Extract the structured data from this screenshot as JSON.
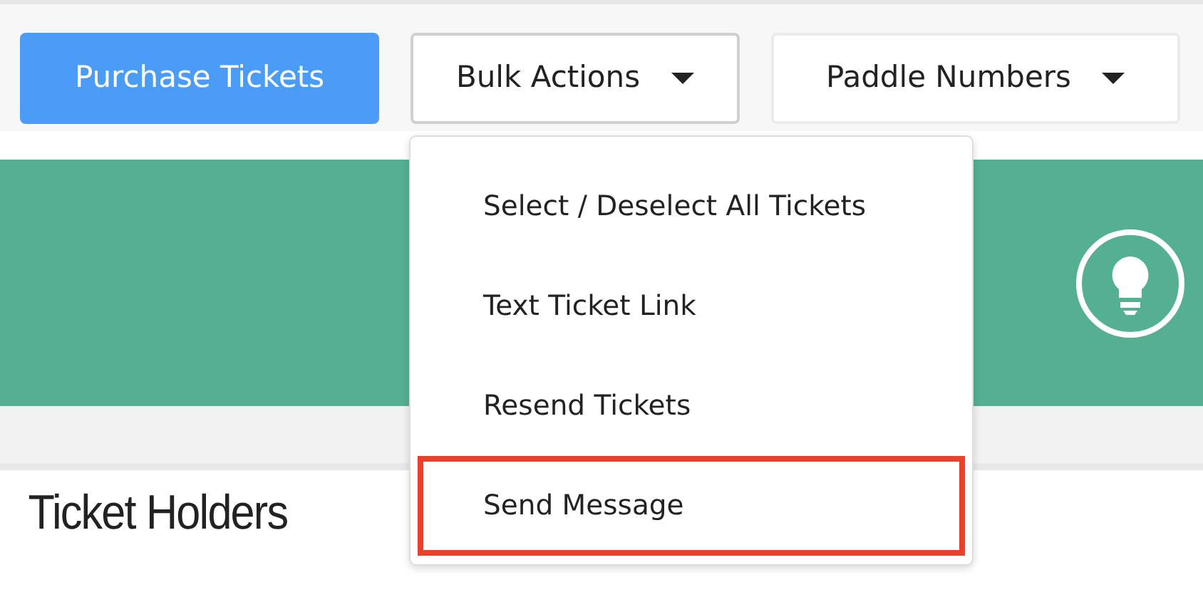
{
  "toolbar": {
    "buttons": [
      {
        "label": "Purchase Tickets",
        "kind": "primary"
      },
      {
        "label": "Bulk Actions",
        "kind": "dropdown",
        "expanded": true
      },
      {
        "label": "Paddle Numbers",
        "kind": "dropdown",
        "expanded": false
      }
    ]
  },
  "bulk_actions_menu": {
    "items": [
      {
        "label": "Select / Deselect All Tickets",
        "highlighted": false
      },
      {
        "label": "Text Ticket Link",
        "highlighted": false
      },
      {
        "label": "Resend Tickets",
        "highlighted": false
      },
      {
        "label": "Send Message",
        "highlighted": true
      }
    ]
  },
  "section": {
    "title": "Ticket Holders"
  }
}
